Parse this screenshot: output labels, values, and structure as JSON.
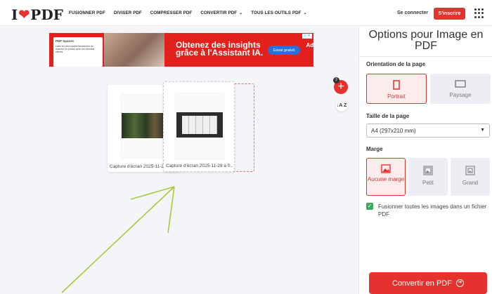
{
  "header": {
    "logo_pre": "I",
    "logo_post": "PDF",
    "nav": [
      {
        "label": "FUSIONNER PDF"
      },
      {
        "label": "DIVISER PDF"
      },
      {
        "label": "COMPRESSER PDF"
      },
      {
        "label": "CONVERTIR PDF",
        "chevron": true
      },
      {
        "label": "TOUS LES OUTILS PDF",
        "chevron": true
      }
    ],
    "login": "Se connecter",
    "signup": "S'inscrire"
  },
  "ad": {
    "card_title": "PDF Spaces",
    "card_text": "Liste les principales tendances du marché en phase avec les besoins clients.",
    "headline": "Obtenez des insights grâce à l'Assistant IA.",
    "cta": "Essai gratuit",
    "brand": "Adobe Acrobat Studio"
  },
  "files": [
    {
      "name": "Capture d'écran 2025-11-2..."
    },
    {
      "name": "Capture d'écran 2025-11-28 à 0..."
    }
  ],
  "toolbar": {
    "file_count": "2",
    "add_label": "+",
    "sort_label": "↓A Z"
  },
  "sidebar": {
    "title": "Options pour Image en PDF",
    "orientation_label": "Orientation de la page",
    "orientation_options": [
      "Portrait",
      "Paysage"
    ],
    "orientation_selected": "Portrait",
    "page_size_label": "Taille de la page",
    "page_size_value": "A4 (297x210 mm)",
    "margin_label": "Marge",
    "margin_options": [
      "Aucune marge",
      "Petit",
      "Grand"
    ],
    "margin_selected": "Aucune marge",
    "merge_checked": true,
    "merge_label": "Fusionner toutes les images dans un fichier PDF",
    "convert_label": "Convertir en PDF"
  },
  "colors": {
    "brand": "#e5322d",
    "check": "#3daa5b",
    "annotation_arrow": "#a8c93a"
  }
}
